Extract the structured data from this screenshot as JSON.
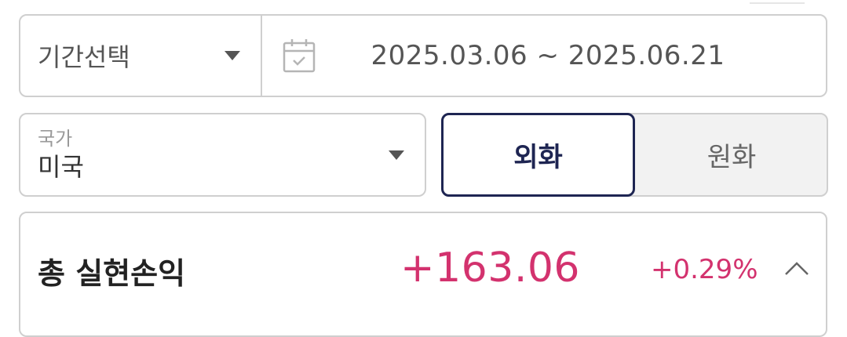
{
  "period": {
    "select_label": "기간선택",
    "date_range": "2025.03.06 ~ 2025.06.21"
  },
  "country": {
    "caption": "국가",
    "value": "미국"
  },
  "currency_toggle": {
    "options": [
      "외화",
      "원화"
    ],
    "selected": "외화"
  },
  "summary": {
    "title": "총 실현손익",
    "amount": "+163.06",
    "rate": "+0.29%"
  },
  "colors": {
    "profit": "#d3326e",
    "toggle_active": "#1e2552",
    "border": "#cfcfcf"
  },
  "icons": [
    "chevron-down-icon",
    "calendar-icon",
    "chevron-up-icon"
  ]
}
